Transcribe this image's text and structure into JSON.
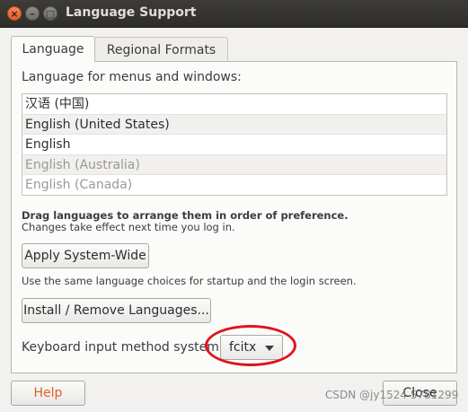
{
  "window": {
    "title": "Language Support",
    "controls": {
      "close": "×",
      "minimize": "–",
      "maximize": "□"
    }
  },
  "tabs": [
    {
      "label": "Language",
      "active": true
    },
    {
      "label": "Regional Formats",
      "active": false
    }
  ],
  "language_section": {
    "heading": "Language for menus and windows:",
    "languages": [
      "汉语 (中国)",
      "English (United States)",
      "English",
      "English (Australia)",
      "English (Canada)"
    ],
    "drag_hint": "Drag languages to arrange them in order of preference.",
    "change_hint": "Changes take effect next time you log in."
  },
  "buttons": {
    "apply_system_wide": "Apply System-Wide",
    "apply_description": "Use the same language choices for startup and the login screen.",
    "install_remove": "Install / Remove Languages...",
    "help": "Help",
    "close": "Close"
  },
  "keyboard": {
    "label": "Keyboard input method system:",
    "selected": "fcitx"
  },
  "overlay": {
    "watermark": "CSDN @jy1524 5781299",
    "highlight_color": "#e0141c"
  },
  "colors": {
    "help_text": "#e0611f",
    "titlebar": "#3d3c38",
    "close_button": "#e05d2c"
  }
}
